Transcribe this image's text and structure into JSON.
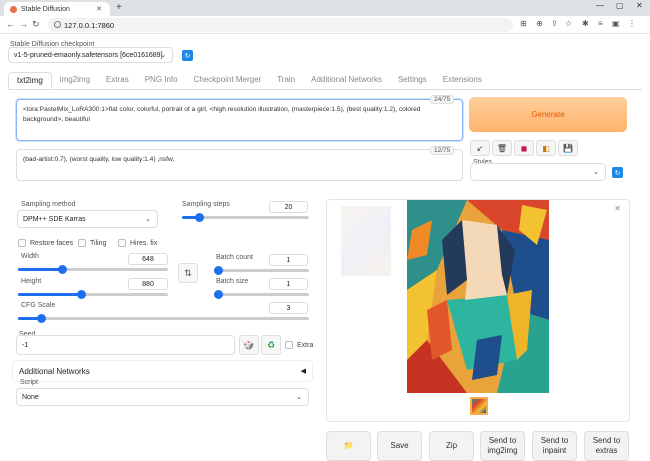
{
  "browser": {
    "tab_title": "Stable Diffusion",
    "url": "127.0.0.1:7860",
    "win_min": "—",
    "win_max": "▢",
    "win_close": "✕",
    "new_tab": "+"
  },
  "checkpoint": {
    "label": "Stable Diffusion checkpoint",
    "value": "v1-5-pruned-emaonly.safetensors [6ce0161689]"
  },
  "tabs": [
    "txt2img",
    "img2img",
    "Extras",
    "PNG Info",
    "Checkpoint Merger",
    "Train",
    "Additional Networks",
    "Settings",
    "Extensions"
  ],
  "prompt": {
    "positive": "<lora:PastelMix_LoRA300:1>flat color, colorful, portrait of a girl, <high resolution illustration, (masterpiece:1.5), (best quality:1.2), colored background>, beautiful",
    "positive_count": "24/75",
    "negative": "(bad-artist:0.7), (worst quality, low quality:1.4) ,nsfw,",
    "negative_count": "12/75"
  },
  "generate_label": "Generate",
  "styles_label": "Styles",
  "tool_icons": [
    "↙",
    "🗑",
    "◼",
    "◧",
    "💾"
  ],
  "sampling": {
    "method_label": "Sampling method",
    "method_value": "DPM++ SDE Karras",
    "steps_label": "Sampling steps",
    "steps_value": "20",
    "steps_fraction": 0.13
  },
  "checks": {
    "restore_faces": "Restore faces",
    "tiling": "Tiling",
    "hires_fix": "Hires. fix"
  },
  "size": {
    "width_label": "Width",
    "width_value": "648",
    "width_fraction": 0.29,
    "height_label": "Height",
    "height_value": "880",
    "height_fraction": 0.42,
    "swap_icon": "⇅"
  },
  "batch": {
    "count_label": "Batch count",
    "count_value": "1",
    "size_label": "Batch size",
    "size_value": "1"
  },
  "cfg": {
    "label": "CFG Scale",
    "value": "3",
    "fraction": 0.08
  },
  "seed": {
    "label": "Seed",
    "value": "-1",
    "dice_icon": "🎲",
    "recycle_icon": "♻",
    "extra_label": "Extra"
  },
  "additional_networks": {
    "title": "Additional Networks",
    "arrow": "◀"
  },
  "script": {
    "label": "Script",
    "value": "None"
  },
  "output": {
    "close_icon": "✕",
    "buttons": [
      "📁",
      "Save",
      "Zip",
      "Send to img2img",
      "Send to inpaint",
      "Send to extras"
    ]
  }
}
